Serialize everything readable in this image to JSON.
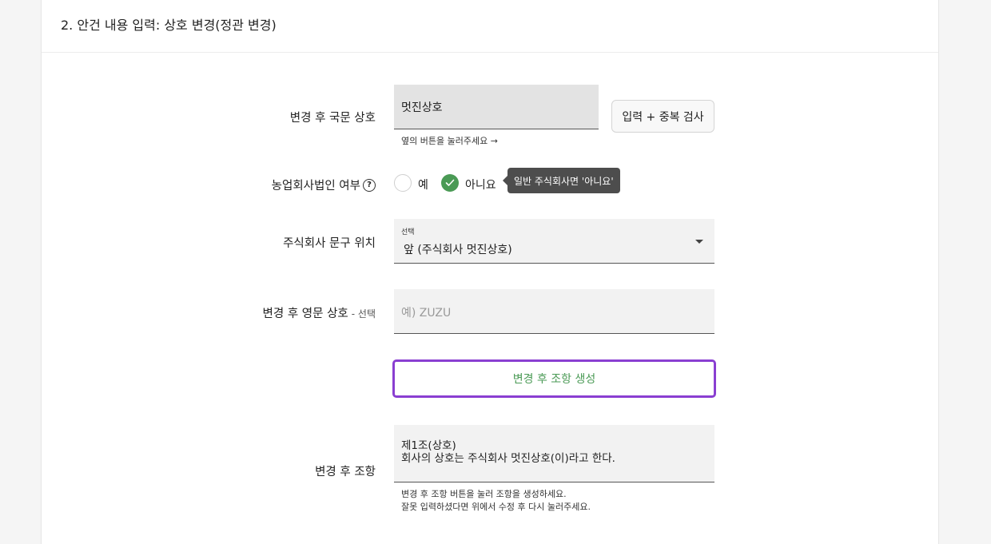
{
  "section": {
    "title": "2. 안건 내용 입력: 상호 변경(정관 변경)"
  },
  "korean_name": {
    "label": "변경 후 국문 상호",
    "value": "멋진상호",
    "helper": "옆의 버튼을 눌러주세요 →",
    "button_label": "입력 + 중복 검사"
  },
  "agri_corp": {
    "label": "농업회사법인 여부",
    "help_icon": "?",
    "options": [
      "예",
      "아니요"
    ],
    "selected": "아니요",
    "tooltip": "일반 주식회사면 '아니요'"
  },
  "position": {
    "label": "주식회사 문구 위치",
    "select_caption": "선택",
    "selected_value": "앞 (주식회사 멋진상호)"
  },
  "english_name": {
    "label": "변경 후 영문 상호",
    "optional_note": "- 선택",
    "placeholder": "예) ZUZU"
  },
  "generate": {
    "button_label": "변경 후 조항 생성"
  },
  "article": {
    "label": "변경 후 조항",
    "line1": "제1조(상호)",
    "line2": "회사의 상호는 주식회사 멋진상호(이)라고 한다.",
    "helper_line1": "변경 후 조항 버튼을 눌러 조항을 생성하세요.",
    "helper_line2": "잘못 입력하셨다면 위에서 수정 후 다시 눌러주세요."
  },
  "colors": {
    "accent_green": "#4a9a55",
    "highlight_purple": "#8a3fd1",
    "tooltip_bg": "#4d4d4d"
  }
}
